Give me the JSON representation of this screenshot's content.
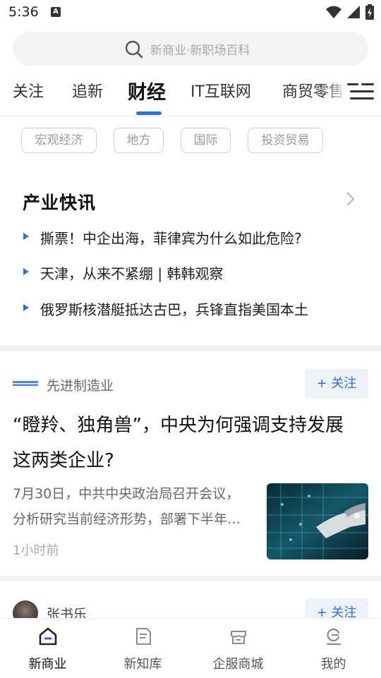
{
  "status_bar": {
    "time": "5:36",
    "notification_badge": "A"
  },
  "search": {
    "placeholder": "新商业·新职场百科"
  },
  "tabs": [
    {
      "label": "关注",
      "active": false
    },
    {
      "label": "追新",
      "active": false
    },
    {
      "label": "财经",
      "active": true
    },
    {
      "label": "IT互联网",
      "active": false
    },
    {
      "label": "商贸零售",
      "active": false
    }
  ],
  "sub_tabs": [
    "宏观经济",
    "地方",
    "国际",
    "投资贸易"
  ],
  "section": {
    "title": "产业快讯",
    "items": [
      "撕票！中企出海，菲律宾为什么如此危险?",
      "天津，从来不紧绷 | 韩韩观察",
      "俄罗斯核潜艇抵达古巴，兵锋直指美国本土"
    ]
  },
  "article": {
    "source": "先进制造业",
    "follow_label": "关注",
    "title_line1": "“瞪羚、独角兽”，中央为何强调支持发展",
    "title_line2": "这两类企业?",
    "summary_line1": "7月30日，中共中央政治局召开会议，",
    "summary_line2": "分析研究当前经济形势，部署下半年…",
    "time_ago": "1小时前"
  },
  "next_item": {
    "author": "张书乐",
    "follow_label": "关注"
  },
  "bottom_nav": [
    {
      "label": "新商业",
      "icon": "home-icon",
      "active": true
    },
    {
      "label": "新知库",
      "icon": "document-icon",
      "active": false
    },
    {
      "label": "企服商城",
      "icon": "store-icon",
      "active": false
    },
    {
      "label": "我的",
      "icon": "profile-icon",
      "active": false
    }
  ],
  "colors": {
    "accent": "#2f6fd8",
    "chip_border": "#cfcfcf",
    "follow_bg": "#eef1f6"
  }
}
